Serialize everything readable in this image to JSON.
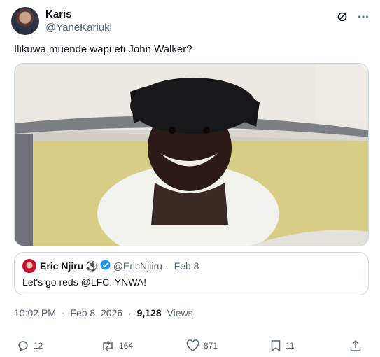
{
  "author": {
    "display_name": "Karis",
    "handle": "@YaneKariuki"
  },
  "header_icons": [
    "grok-icon",
    "more-icon"
  ],
  "tweet": {
    "text": "Ilikuwa muende wapi eti John Walker?"
  },
  "media": {
    "description_icon": "photo"
  },
  "quote": {
    "display_name": "Eric Njiru",
    "emoji": "⚽",
    "handle": "@EricNjiiru",
    "separator": "·",
    "date": "Feb 8",
    "text": "Let's go reds @LFC. YNWA!"
  },
  "meta": {
    "time": "10:02 PM",
    "separator": "·",
    "date": "Feb 8, 2026",
    "separator2": "·",
    "views_count": "9,128",
    "views_label": "Views"
  },
  "actions": {
    "replies": "12",
    "reposts": "164",
    "likes": "871",
    "bookmarks": "11"
  },
  "colors": {
    "text": "#0f1419",
    "secondary": "#536471",
    "border": "#cfd9de",
    "verified": "#1d9bf0"
  }
}
